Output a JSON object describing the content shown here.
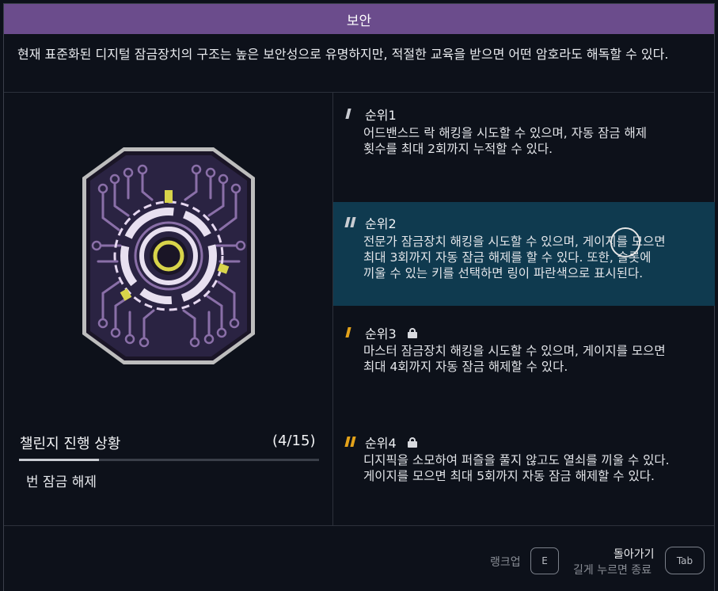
{
  "header": {
    "title": "보안"
  },
  "description": "현재 표준화된 디지털 잠금장치의 구조는 높은 보안성으로 유명하지만, 적절한 교육을 받으면 어떤 암호라도 해독할 수 있다.",
  "badge": {
    "icon": "digital-lock-circuit-badge",
    "accent": "#d8d44a",
    "body": "#2a2342",
    "trace": "#8a6fa8"
  },
  "progress": {
    "title": "챌린지 진행 상황",
    "count": "(4/15)",
    "current": 4,
    "total": 15,
    "subtitle": "번 잠금 해제"
  },
  "ranks": [
    {
      "label": "순위1",
      "locked": false,
      "active": false,
      "mark_color": "#c9ccd2",
      "text": "어드밴스드 락 해킹을 시도할 수 있으며, 자동 잠금 해제\n횟수를 최대 2회까지 누적할 수 있다."
    },
    {
      "label": "순위2",
      "locked": false,
      "active": true,
      "mark_color": "#c9ccd2",
      "text": "전문가 잠금장치 해킹을 시도할 수 있으며, 게이지를 모으면\n최대 3회까지 자동 잠금 해제를 할 수 있다. 또한, 슬롯에\n끼울 수 있는 키를 선택하면 링이 파란색으로 표시된다."
    },
    {
      "label": "순위3",
      "locked": true,
      "active": false,
      "mark_color": "#e3a21a",
      "text": "마스터 잠금장치 해킹을 시도할 수 있으며, 게이지를 모으면\n최대 4회까지 자동 잠금 해제할 수 있다."
    },
    {
      "label": "순위4",
      "locked": true,
      "active": false,
      "mark_color": "#e3a21a",
      "text": "디지픽을 소모하여 퍼즐을 풀지 않고도 열쇠를 끼울 수 있다.\n게이지를 모으면 최대 5회까지 자동 잠금 해제할 수 있다."
    }
  ],
  "footer": {
    "rankup_label": "랭크업",
    "rankup_key": "E",
    "back_label": "돌아가기",
    "back_sub": "길게 누르면 종료",
    "back_key": "Tab"
  }
}
